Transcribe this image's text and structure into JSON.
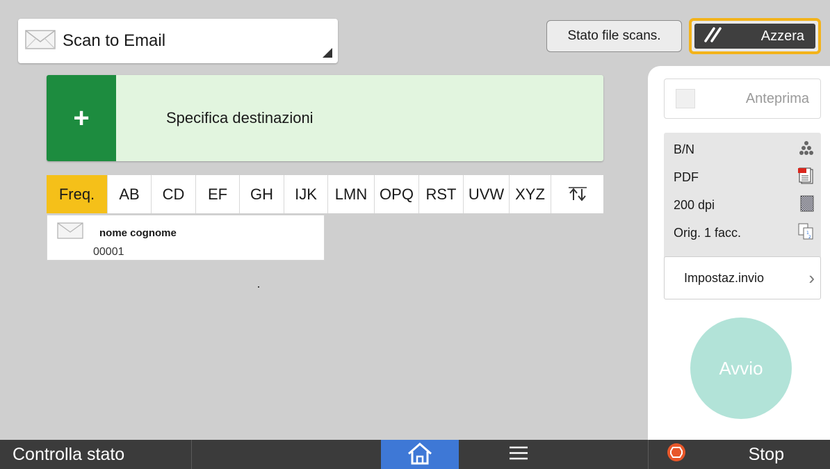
{
  "function_select": {
    "label": "Scan to Email",
    "icon": "envelope-icon"
  },
  "header": {
    "stato_label": "Stato file scans.",
    "azzera_label": "Azzera",
    "azzera_icon": "reset-slash-icon",
    "accent_color": "#f3b31b"
  },
  "destination": {
    "plus": "+",
    "label": "Specifica destinazioni"
  },
  "tabs": [
    {
      "label": "Freq.",
      "active": true
    },
    {
      "label": "AB"
    },
    {
      "label": "CD"
    },
    {
      "label": "EF"
    },
    {
      "label": "GH"
    },
    {
      "label": "IJK"
    },
    {
      "label": "LMN"
    },
    {
      "label": "OPQ"
    },
    {
      "label": "RST"
    },
    {
      "label": "UVW"
    },
    {
      "label": "XYZ"
    }
  ],
  "tab_swap_icon": "swap-arrows-icon",
  "address_entry": {
    "name": "nome cognome",
    "number": "00001",
    "icon": "envelope-icon"
  },
  "right_panel": {
    "preview_label": "Anteprima",
    "settings": [
      {
        "label": "B/N",
        "icon": "color-mode-icon"
      },
      {
        "label": "PDF",
        "icon": "pdf-file-icon"
      },
      {
        "label": "200 dpi",
        "icon": "resolution-icon"
      },
      {
        "label": "Orig. 1 facc.",
        "icon": "single-sided-icon"
      }
    ],
    "impostaz_label": "Impostaz.invio",
    "start_label": "Avvio",
    "start_color": "#b2e3d8"
  },
  "bottom_bar": {
    "check_status_label": "Controlla stato",
    "home_icon": "home-icon",
    "menu_icon": "menu-icon",
    "stop_label": "Stop",
    "stop_icon": "stop-icon"
  }
}
